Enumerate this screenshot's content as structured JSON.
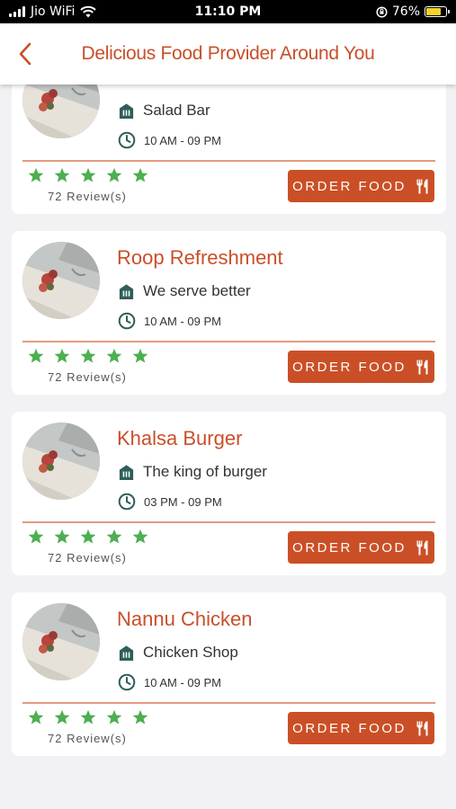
{
  "status_bar": {
    "carrier": "Jio WiFi",
    "time": "11:10 PM",
    "battery": "76%",
    "battery_level": 0.76
  },
  "header": {
    "title": "Delicious Food Provider Around You"
  },
  "colors": {
    "accent": "#c94f2a",
    "button": "#cb4f26",
    "star": "#4caf50",
    "icon": "#2f5f5a"
  },
  "restaurants": [
    {
      "name": "",
      "tagline": "Salad Bar",
      "hours": "10 AM - 09 PM",
      "rating": 5,
      "reviews": "72 Review(s)",
      "order_label": "ORDER FOOD"
    },
    {
      "name": "Roop Refreshment",
      "tagline": "We serve better",
      "hours": "10 AM - 09 PM",
      "rating": 5,
      "reviews": "72 Review(s)",
      "order_label": "ORDER FOOD"
    },
    {
      "name": "Khalsa Burger",
      "tagline": "The king of burger",
      "hours": "03 PM - 09 PM",
      "rating": 5,
      "reviews": "72 Review(s)",
      "order_label": "ORDER FOOD"
    },
    {
      "name": "Nannu Chicken",
      "tagline": "Chicken Shop",
      "hours": "10 AM - 09 PM",
      "rating": 5,
      "reviews": "72 Review(s)",
      "order_label": "ORDER FOOD"
    }
  ]
}
